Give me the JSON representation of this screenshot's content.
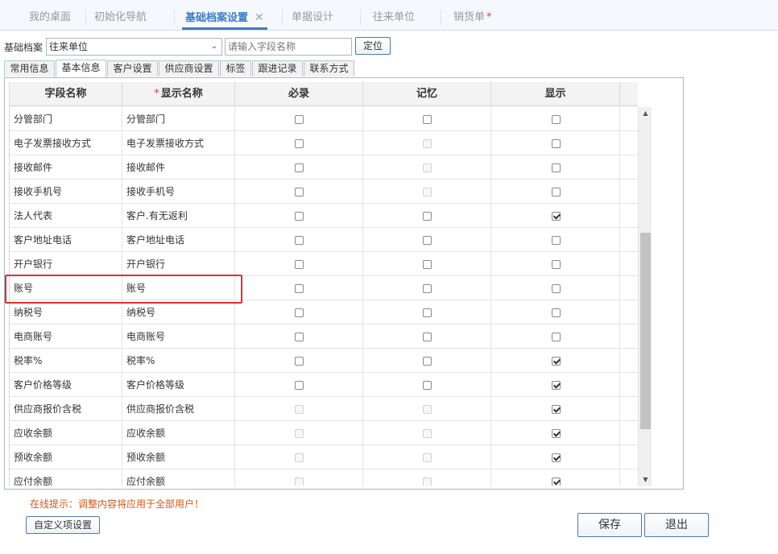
{
  "top_tabs": [
    {
      "label": "我的桌面"
    },
    {
      "label": "初始化导航"
    },
    {
      "label": "基础档案设置",
      "close": "✕"
    },
    {
      "label": "单据设计"
    },
    {
      "label": "往来单位"
    },
    {
      "label": "销货单",
      "mark": "*"
    }
  ],
  "toolbar": {
    "archive_label": "基础档案",
    "archive_value": "往来单位",
    "search_placeholder": "请输入字段名称",
    "locate_label": "定位"
  },
  "sub_tabs": [
    "常用信息",
    "基本信息",
    "客户设置",
    "供应商设置",
    "标签",
    "跟进记录",
    "联系方式"
  ],
  "active_sub_tab": "基本信息",
  "grid": {
    "columns": {
      "field": "字段名称",
      "display_required_mark": "*",
      "display": "显示名称",
      "required": "必录",
      "memory": "记忆",
      "show": "显示"
    },
    "rows": [
      {
        "field": "分管部门",
        "display": "分管部门",
        "required": "off",
        "memory": "off",
        "show": "off"
      },
      {
        "field": "电子发票接收方式",
        "display": "电子发票接收方式",
        "required": "off",
        "memory": "disabled",
        "show": "off"
      },
      {
        "field": "接收邮件",
        "display": "接收邮件",
        "required": "off",
        "memory": "disabled",
        "show": "off"
      },
      {
        "field": "接收手机号",
        "display": "接收手机号",
        "required": "off",
        "memory": "disabled",
        "show": "off"
      },
      {
        "field": "法人代表",
        "display": "客户.有无返利",
        "required": "off",
        "memory": "off",
        "show": "on"
      },
      {
        "field": "客户地址电话",
        "display": "客户地址电话",
        "required": "off",
        "memory": "off",
        "show": "off"
      },
      {
        "field": "开户银行",
        "display": "开户银行",
        "required": "off",
        "memory": "off",
        "show": "off"
      },
      {
        "field": "账号",
        "display": "账号",
        "required": "off",
        "memory": "off",
        "show": "off"
      },
      {
        "field": "纳税号",
        "display": "纳税号",
        "required": "off",
        "memory": "off",
        "show": "off"
      },
      {
        "field": "电商账号",
        "display": "电商账号",
        "required": "off",
        "memory": "off",
        "show": "off"
      },
      {
        "field": "税率%",
        "display": "税率%",
        "required": "off",
        "memory": "off",
        "show": "on"
      },
      {
        "field": "客户价格等级",
        "display": "客户价格等级",
        "required": "off",
        "memory": "off",
        "show": "on"
      },
      {
        "field": "供应商报价含税",
        "display": "供应商报价含税",
        "required": "disabled",
        "memory": "disabled",
        "show": "on"
      },
      {
        "field": "应收余额",
        "display": "应收余额",
        "required": "disabled",
        "memory": "disabled",
        "show": "on"
      },
      {
        "field": "预收余额",
        "display": "预收余额",
        "required": "disabled",
        "memory": "disabled",
        "show": "on"
      },
      {
        "field": "应付余额",
        "display": "应付余额",
        "required": "disabled",
        "memory": "disabled",
        "show": "on"
      }
    ]
  },
  "icons": {
    "scroll_up": "▲",
    "scroll_down": "▼",
    "dropdown": "⌄"
  },
  "footer": {
    "tip": "在线提示：调整内容将应用于全部用户！",
    "custom_button": "自定义项设置",
    "save_button": "保存",
    "exit_button": "退出"
  },
  "colors": {
    "accent": "#3c7cc4",
    "highlight": "#e02f2f",
    "tip": "#d2581c"
  }
}
